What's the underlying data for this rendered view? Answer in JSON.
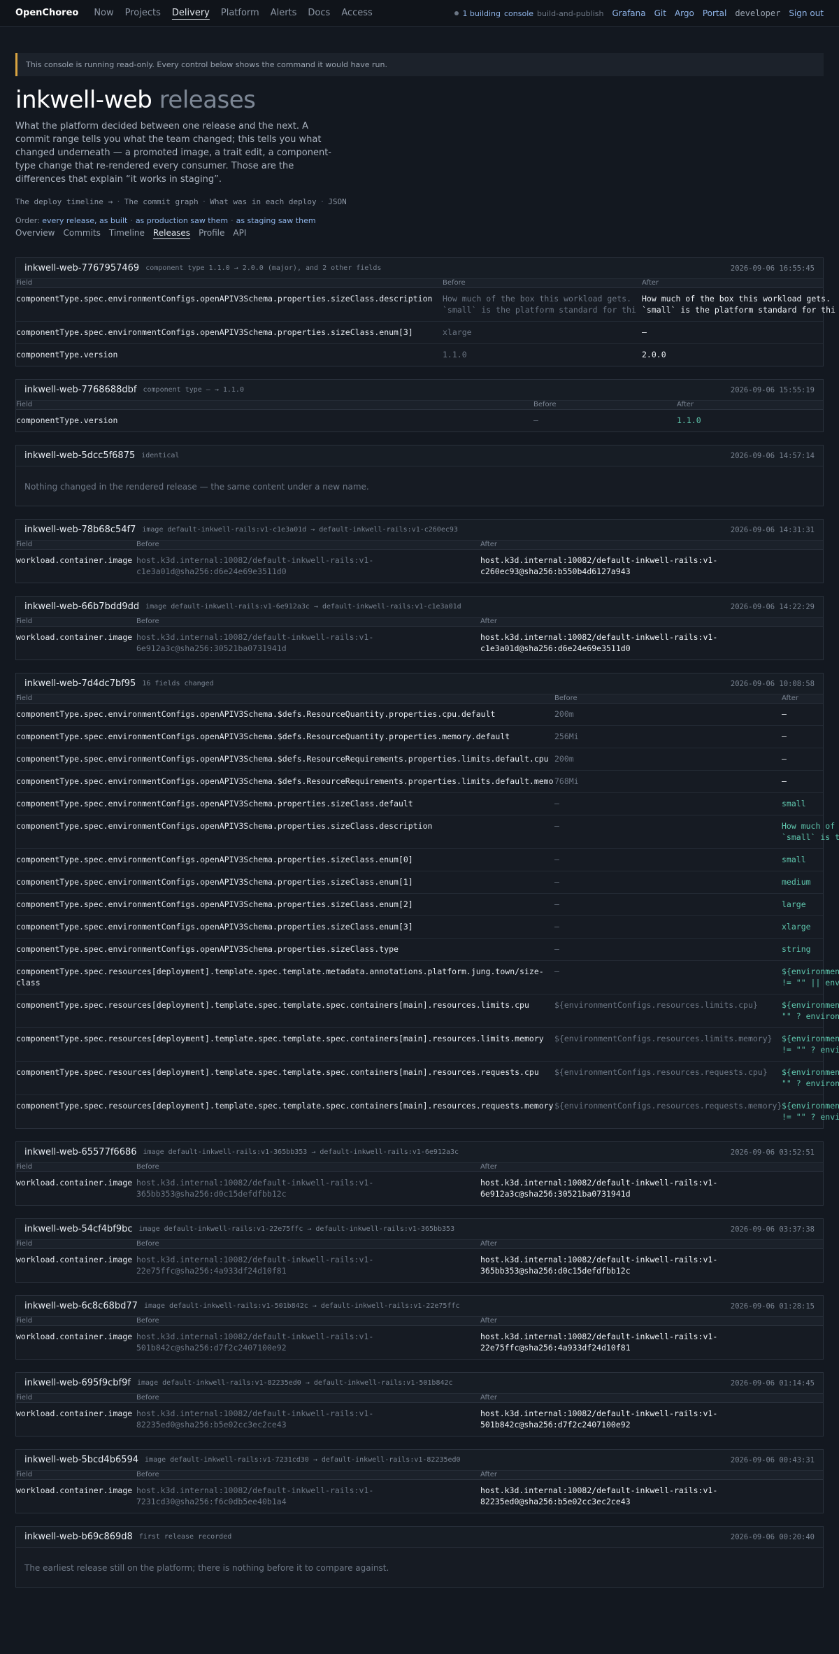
{
  "nav": {
    "brand": "OpenChoreo",
    "links": [
      "Now",
      "Projects",
      "Delivery",
      "Platform",
      "Alerts",
      "Docs",
      "Access"
    ],
    "active": 2,
    "status_count": "1 building",
    "status_app": "console",
    "status_pipeline": "build-and-publish",
    "ext_links": [
      "Grafana",
      "Git",
      "Argo",
      "Portal"
    ],
    "user": "developer",
    "signout": "Sign out"
  },
  "notice": "This console is running read-only. Every control below shows the command it would have run.",
  "page": {
    "title_main": "inkwell-web",
    "title_sub": "releases",
    "lede": "What the platform decided between one release and the next. A commit range tells you what the team changed; this tells you what changed underneath — a promoted image, a trait edit, a component-type change that re-rendered every consumer. Those are the differences that explain “it works in staging”.",
    "related": [
      "The deploy timeline →",
      "The commit graph",
      "What was in each deploy",
      "JSON"
    ],
    "order_label": "Order:",
    "order_options": [
      "every release, as built",
      "as production saw them",
      "as staging saw them"
    ],
    "tabs": [
      "Overview",
      "Commits",
      "Timeline",
      "Releases",
      "Profile",
      "API"
    ],
    "active_tab": 3
  },
  "columns": {
    "field": "Field",
    "before": "Before",
    "after": "After"
  },
  "releases": [
    {
      "name": "inkwell-web-7767957469",
      "summary": "component type 1.1.0 → 2.0.0 (major), and 2 other fields",
      "time": "2026-09-06 16:55:45",
      "rows": [
        {
          "field": "componentType.spec.environmentConfigs.openAPIV3Schema.properties.sizeClass.description",
          "before": "How much of the box this workload gets.\n`small` is the platform standard for thi",
          "after": "How much of the box this workload gets.\n`small` is the platform standard for thi"
        },
        {
          "field": "componentType.spec.environmentConfigs.openAPIV3Schema.properties.sizeClass.enum[3]",
          "before": "xlarge",
          "after": "—"
        },
        {
          "field": "componentType.version",
          "before": "1.1.0",
          "after": "2.0.0"
        }
      ]
    },
    {
      "name": "inkwell-web-7768688dbf",
      "summary": "component type — → 1.1.0",
      "time": "2026-09-06 15:55:19",
      "rows": [
        {
          "field": "componentType.version",
          "before": "—",
          "after": "1.1.0",
          "added": true
        }
      ]
    },
    {
      "name": "inkwell-web-5dcc5f6875",
      "summary": "identical",
      "time": "2026-09-06 14:57:14",
      "empty": "Nothing changed in the rendered release — the same content under a new name."
    },
    {
      "name": "inkwell-web-78b68c54f7",
      "summary": "image default-inkwell-rails:v1-c1e3a01d → default-inkwell-rails:v1-c260ec93",
      "time": "2026-09-06 14:31:31",
      "rows": [
        {
          "field": "workload.container.image",
          "before": "host.k3d.internal:10082/default-inkwell-rails:v1-\nc1e3a01d@sha256:d6e24e69e3511d0",
          "after": "host.k3d.internal:10082/default-inkwell-rails:v1-\nc260ec93@sha256:b550b4d6127a943"
        }
      ]
    },
    {
      "name": "inkwell-web-66b7bdd9dd",
      "summary": "image default-inkwell-rails:v1-6e912a3c → default-inkwell-rails:v1-c1e3a01d",
      "time": "2026-09-06 14:22:29",
      "rows": [
        {
          "field": "workload.container.image",
          "before": "host.k3d.internal:10082/default-inkwell-rails:v1-\n6e912a3c@sha256:30521ba0731941d",
          "after": "host.k3d.internal:10082/default-inkwell-rails:v1-\nc1e3a01d@sha256:d6e24e69e3511d0"
        }
      ]
    },
    {
      "name": "inkwell-web-7d4dc7bf95",
      "summary": "16 fields changed",
      "time": "2026-09-06 10:08:58",
      "rows": [
        {
          "field": "componentType.spec.environmentConfigs.openAPIV3Schema.$defs.ResourceQuantity.properties.cpu.default",
          "before": "200m",
          "after": "—"
        },
        {
          "field": "componentType.spec.environmentConfigs.openAPIV3Schema.$defs.ResourceQuantity.properties.memory.default",
          "before": "256Mi",
          "after": "—"
        },
        {
          "field": "componentType.spec.environmentConfigs.openAPIV3Schema.$defs.ResourceRequirements.properties.limits.default.cpu",
          "before": "200m",
          "after": "—"
        },
        {
          "field": "componentType.spec.environmentConfigs.openAPIV3Schema.$defs.ResourceRequirements.properties.limits.default.memory",
          "before": "768Mi",
          "after": "—"
        },
        {
          "field": "componentType.spec.environmentConfigs.openAPIV3Schema.properties.sizeClass.default",
          "before": "—",
          "after": "small",
          "added": true
        },
        {
          "field": "componentType.spec.environmentConfigs.openAPIV3Schema.properties.sizeClass.description",
          "before": "—",
          "after": "How much of t\n`small` is th",
          "added": true
        },
        {
          "field": "componentType.spec.environmentConfigs.openAPIV3Schema.properties.sizeClass.enum[0]",
          "before": "—",
          "after": "small",
          "added": true
        },
        {
          "field": "componentType.spec.environmentConfigs.openAPIV3Schema.properties.sizeClass.enum[1]",
          "before": "—",
          "after": "medium",
          "added": true
        },
        {
          "field": "componentType.spec.environmentConfigs.openAPIV3Schema.properties.sizeClass.enum[2]",
          "before": "—",
          "after": "large",
          "added": true
        },
        {
          "field": "componentType.spec.environmentConfigs.openAPIV3Schema.properties.sizeClass.enum[3]",
          "before": "—",
          "after": "xlarge",
          "added": true
        },
        {
          "field": "componentType.spec.environmentConfigs.openAPIV3Schema.properties.sizeClass.type",
          "before": "—",
          "after": "string",
          "added": true
        },
        {
          "field": "componentType.spec.resources[deployment].template.spec.template.metadata.annotations.platform.jung.town/size-\nclass",
          "before": "—",
          "after": "${environment\n!= \"\" || envi",
          "added": true
        },
        {
          "field": "componentType.spec.resources[deployment].template.spec.template.spec.containers[main].resources.limits.cpu",
          "before": "${environmentConfigs.resources.limits.cpu}",
          "after": "${environment\n\"\" ? environm",
          "added": true
        },
        {
          "field": "componentType.spec.resources[deployment].template.spec.template.spec.containers[main].resources.limits.memory",
          "before": "${environmentConfigs.resources.limits.memory}",
          "after": "${environment\n!= \"\" ? envi",
          "added": true
        },
        {
          "field": "componentType.spec.resources[deployment].template.spec.template.spec.containers[main].resources.requests.cpu",
          "before": "${environmentConfigs.resources.requests.cpu}",
          "after": "${environment\n\"\" ? environm",
          "added": true
        },
        {
          "field": "componentType.spec.resources[deployment].template.spec.template.spec.containers[main].resources.requests.memory",
          "before": "${environmentConfigs.resources.requests.memory}",
          "after": "${environment\n!= \"\" ? envi",
          "added": true
        }
      ]
    },
    {
      "name": "inkwell-web-65577f6686",
      "summary": "image default-inkwell-rails:v1-365bb353 → default-inkwell-rails:v1-6e912a3c",
      "time": "2026-09-06 03:52:51",
      "rows": [
        {
          "field": "workload.container.image",
          "before": "host.k3d.internal:10082/default-inkwell-rails:v1-\n365bb353@sha256:d0c15defdfbb12c",
          "after": "host.k3d.internal:10082/default-inkwell-rails:v1-\n6e912a3c@sha256:30521ba0731941d"
        }
      ]
    },
    {
      "name": "inkwell-web-54cf4bf9bc",
      "summary": "image default-inkwell-rails:v1-22e75ffc → default-inkwell-rails:v1-365bb353",
      "time": "2026-09-06 03:37:38",
      "rows": [
        {
          "field": "workload.container.image",
          "before": "host.k3d.internal:10082/default-inkwell-rails:v1-\n22e75ffc@sha256:4a933df24d10f81",
          "after": "host.k3d.internal:10082/default-inkwell-rails:v1-\n365bb353@sha256:d0c15defdfbb12c"
        }
      ]
    },
    {
      "name": "inkwell-web-6c8c68bd77",
      "summary": "image default-inkwell-rails:v1-501b842c → default-inkwell-rails:v1-22e75ffc",
      "time": "2026-09-06 01:28:15",
      "rows": [
        {
          "field": "workload.container.image",
          "before": "host.k3d.internal:10082/default-inkwell-rails:v1-\n501b842c@sha256:d7f2c2407100e92",
          "after": "host.k3d.internal:10082/default-inkwell-rails:v1-\n22e75ffc@sha256:4a933df24d10f81"
        }
      ]
    },
    {
      "name": "inkwell-web-695f9cbf9f",
      "summary": "image default-inkwell-rails:v1-82235ed0 → default-inkwell-rails:v1-501b842c",
      "time": "2026-09-06 01:14:45",
      "rows": [
        {
          "field": "workload.container.image",
          "before": "host.k3d.internal:10082/default-inkwell-rails:v1-\n82235ed0@sha256:b5e02cc3ec2ce43",
          "after": "host.k3d.internal:10082/default-inkwell-rails:v1-\n501b842c@sha256:d7f2c2407100e92"
        }
      ]
    },
    {
      "name": "inkwell-web-5bcd4b6594",
      "summary": "image default-inkwell-rails:v1-7231cd30 → default-inkwell-rails:v1-82235ed0",
      "time": "2026-09-06 00:43:31",
      "rows": [
        {
          "field": "workload.container.image",
          "before": "host.k3d.internal:10082/default-inkwell-rails:v1-\n7231cd30@sha256:f6c0db5ee40b1a4",
          "after": "host.k3d.internal:10082/default-inkwell-rails:v1-\n82235ed0@sha256:b5e02cc3ec2ce43"
        }
      ]
    },
    {
      "name": "inkwell-web-b69c869d8",
      "summary": "first release recorded",
      "time": "2026-09-06 00:20:40",
      "empty": "The earliest release still on the platform; there is nothing before it to compare against."
    }
  ]
}
